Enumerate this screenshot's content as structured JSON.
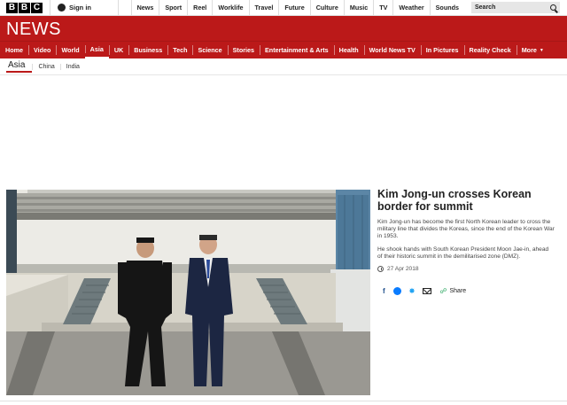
{
  "topbar": {
    "logo": [
      "B",
      "B",
      "C"
    ],
    "signin_label": "Sign in",
    "links": [
      "News",
      "Sport",
      "Reel",
      "Worklife",
      "Travel",
      "Future",
      "Culture",
      "Music",
      "TV",
      "Weather",
      "Sounds"
    ],
    "search_placeholder": "Search"
  },
  "header": {
    "wordmark": "NEWS"
  },
  "nav": {
    "items": [
      "Home",
      "Video",
      "World",
      "Asia",
      "UK",
      "Business",
      "Tech",
      "Science",
      "Stories",
      "Entertainment & Arts",
      "Health",
      "World News TV",
      "In Pictures",
      "Reality Check"
    ],
    "active": "Asia",
    "more_label": "More"
  },
  "subnav": {
    "current": "Asia",
    "items": [
      "China",
      "India"
    ]
  },
  "story": {
    "headline": "Kim Jong-un crosses Korean border for summit",
    "para1": "Kim Jong-un has become the first North Korean leader to cross the military line that divides the Koreas, since the end of the Korean War in 1953.",
    "para2": "He shook hands with South Korean President Moon Jae-in, ahead of their historic summit in the demilitarised zone (DMZ).",
    "date": "27 Apr 2018",
    "share_label": "Share"
  },
  "colors": {
    "brand_red": "#bb1919",
    "link_blue": "#1d4e8c"
  }
}
